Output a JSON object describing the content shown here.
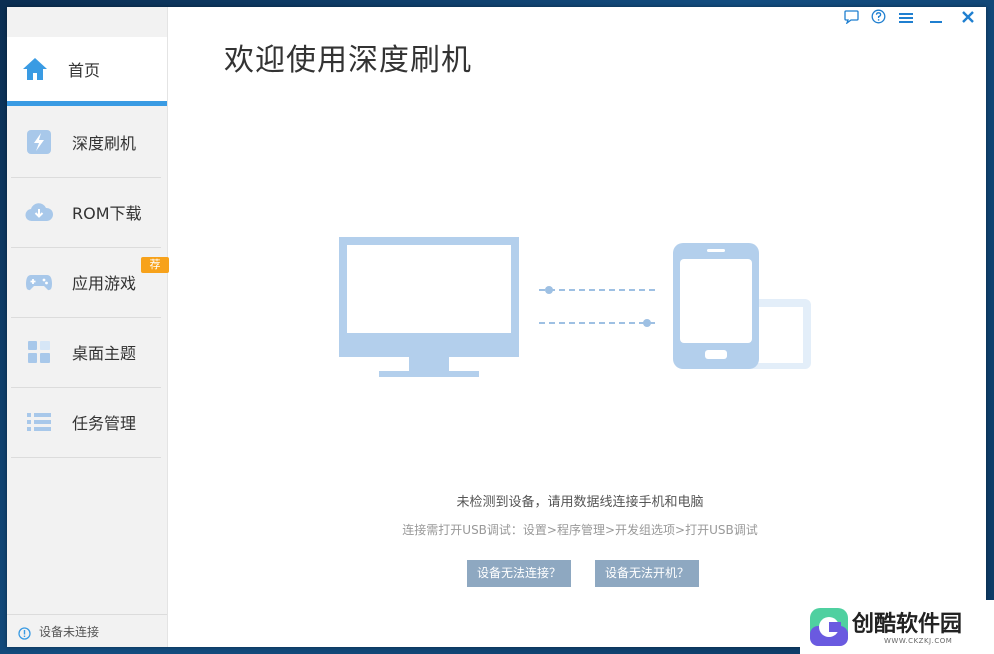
{
  "window": {
    "controls": [
      {
        "name": "feedback-icon"
      },
      {
        "name": "help-icon"
      },
      {
        "name": "menu-icon"
      },
      {
        "name": "minimize-icon"
      },
      {
        "name": "close-icon"
      }
    ]
  },
  "sidebar": {
    "items": [
      {
        "label": "首页",
        "icon": "home-icon"
      },
      {
        "label": "深度刷机",
        "icon": "flash-icon"
      },
      {
        "label": "ROM下载",
        "icon": "cloud-download-icon"
      },
      {
        "label": "应用游戏",
        "icon": "gamepad-icon",
        "badge": "荐"
      },
      {
        "label": "桌面主题",
        "icon": "grid-icon"
      },
      {
        "label": "任务管理",
        "icon": "list-icon"
      }
    ],
    "status": {
      "icon": "info-icon",
      "text": "设备未连接"
    }
  },
  "main": {
    "title": "欢迎使用深度刷机",
    "message": "未检测到设备，请用数据线连接手机和电脑",
    "hint": "连接需打开USB调试：设置>程序管理>开发组选项>打开USB调试",
    "buttons": [
      "设备无法连接？",
      "设备无法开机？"
    ]
  },
  "watermark": {
    "text": "创酷软件园",
    "url": "WWW.CKZKJ.COM"
  },
  "colors": {
    "accent": "#3a9be3",
    "illustration": "#b3cfec",
    "button": "#8ea8c1",
    "badge": "#f7a21b"
  }
}
